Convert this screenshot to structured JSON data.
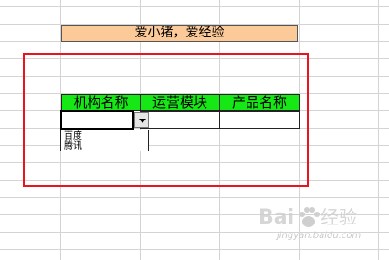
{
  "sheet": {
    "banner_text": "爱小猪，爱经验",
    "headers": [
      "机构名称",
      "运营模块",
      "产品名称"
    ],
    "dropdown_options": [
      "百度",
      "腾讯"
    ]
  },
  "watermark": {
    "brand_text": "Baidu经验",
    "url_text": "jingyan.baidu.com"
  },
  "colors": {
    "banner_fill": "#fcc998",
    "header_fill": "#16e816",
    "highlight_border": "#e8141e",
    "grid_line": "#d4d4d4"
  }
}
